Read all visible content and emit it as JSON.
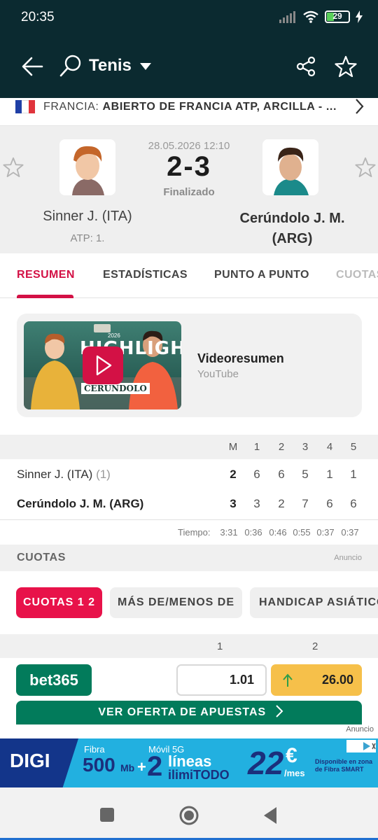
{
  "status_bar": {
    "time": "20:35",
    "battery": "29"
  },
  "app_bar": {
    "title": "Tenis"
  },
  "breadcrumb": {
    "country": "FRANCIA:",
    "tournament": "ABIERTO DE FRANCIA ATP, ARCILLA - ..."
  },
  "match": {
    "datetime": "28.05.2026 12:10",
    "score": "2-3",
    "status": "Finalizado",
    "home": {
      "name": "Sinner J. (ITA)",
      "rank": "ATP: 1."
    },
    "away": {
      "name": "Cerúndolo J. M. (ARG)"
    }
  },
  "tabs": [
    {
      "label": "RESUMEN"
    },
    {
      "label": "ESTADÍSTICAS"
    },
    {
      "label": "PUNTO A PUNTO"
    },
    {
      "label": "CUOTAS"
    }
  ],
  "video": {
    "title": "Videoresumen",
    "source": "YouTube",
    "thumb_text": "HIGHLIGHTS",
    "thumb_name": "CERUNDOLO",
    "thumb_year": "2026"
  },
  "scoretable": {
    "columns": [
      "M",
      "1",
      "2",
      "3",
      "4",
      "5"
    ],
    "rows": [
      {
        "name": "Sinner J. (ITA)",
        "seed": "(1)",
        "values": [
          "2",
          "6",
          "6",
          "5",
          "1",
          "1"
        ]
      },
      {
        "name": "Cerúndolo J. M. (ARG)",
        "seed": "",
        "values": [
          "3",
          "3",
          "2",
          "7",
          "6",
          "6"
        ]
      }
    ],
    "time_label": "Tiempo:",
    "times": [
      "3:31",
      "0:36",
      "0:46",
      "0:55",
      "0:37",
      "0:37"
    ]
  },
  "cuotas": {
    "title": "CUOTAS",
    "ad_label": "Anuncio",
    "chips": [
      "CUOTAS 1 2",
      "MÁS DE/MENOS DE",
      "HANDICAP ASIÁTICO"
    ],
    "col_1": "1",
    "col_2": "2",
    "bookmaker": "bet365",
    "odd_1": "1.01",
    "odd_2": "26.00",
    "offer_button": "VER OFERTA DE APUESTAS"
  },
  "ad": {
    "label": "Anuncio",
    "brand": "DIGI",
    "fibra": "Fibra",
    "speed": "500",
    "speed_unit": "Mb",
    "movil": "Móvil 5G",
    "lines_num": "2",
    "lines_text": "líneas",
    "ilimitodo": "ilimiTODO",
    "price": "22",
    "currency": "€",
    "per": "/mes",
    "note_1": "Disponible en zona",
    "note_2": "de Fibra SMART"
  },
  "colors": {
    "accent": "#d31145",
    "topbar": "#0b2a30",
    "bet365": "#027b5b",
    "odd_up": "#f6c04a"
  }
}
